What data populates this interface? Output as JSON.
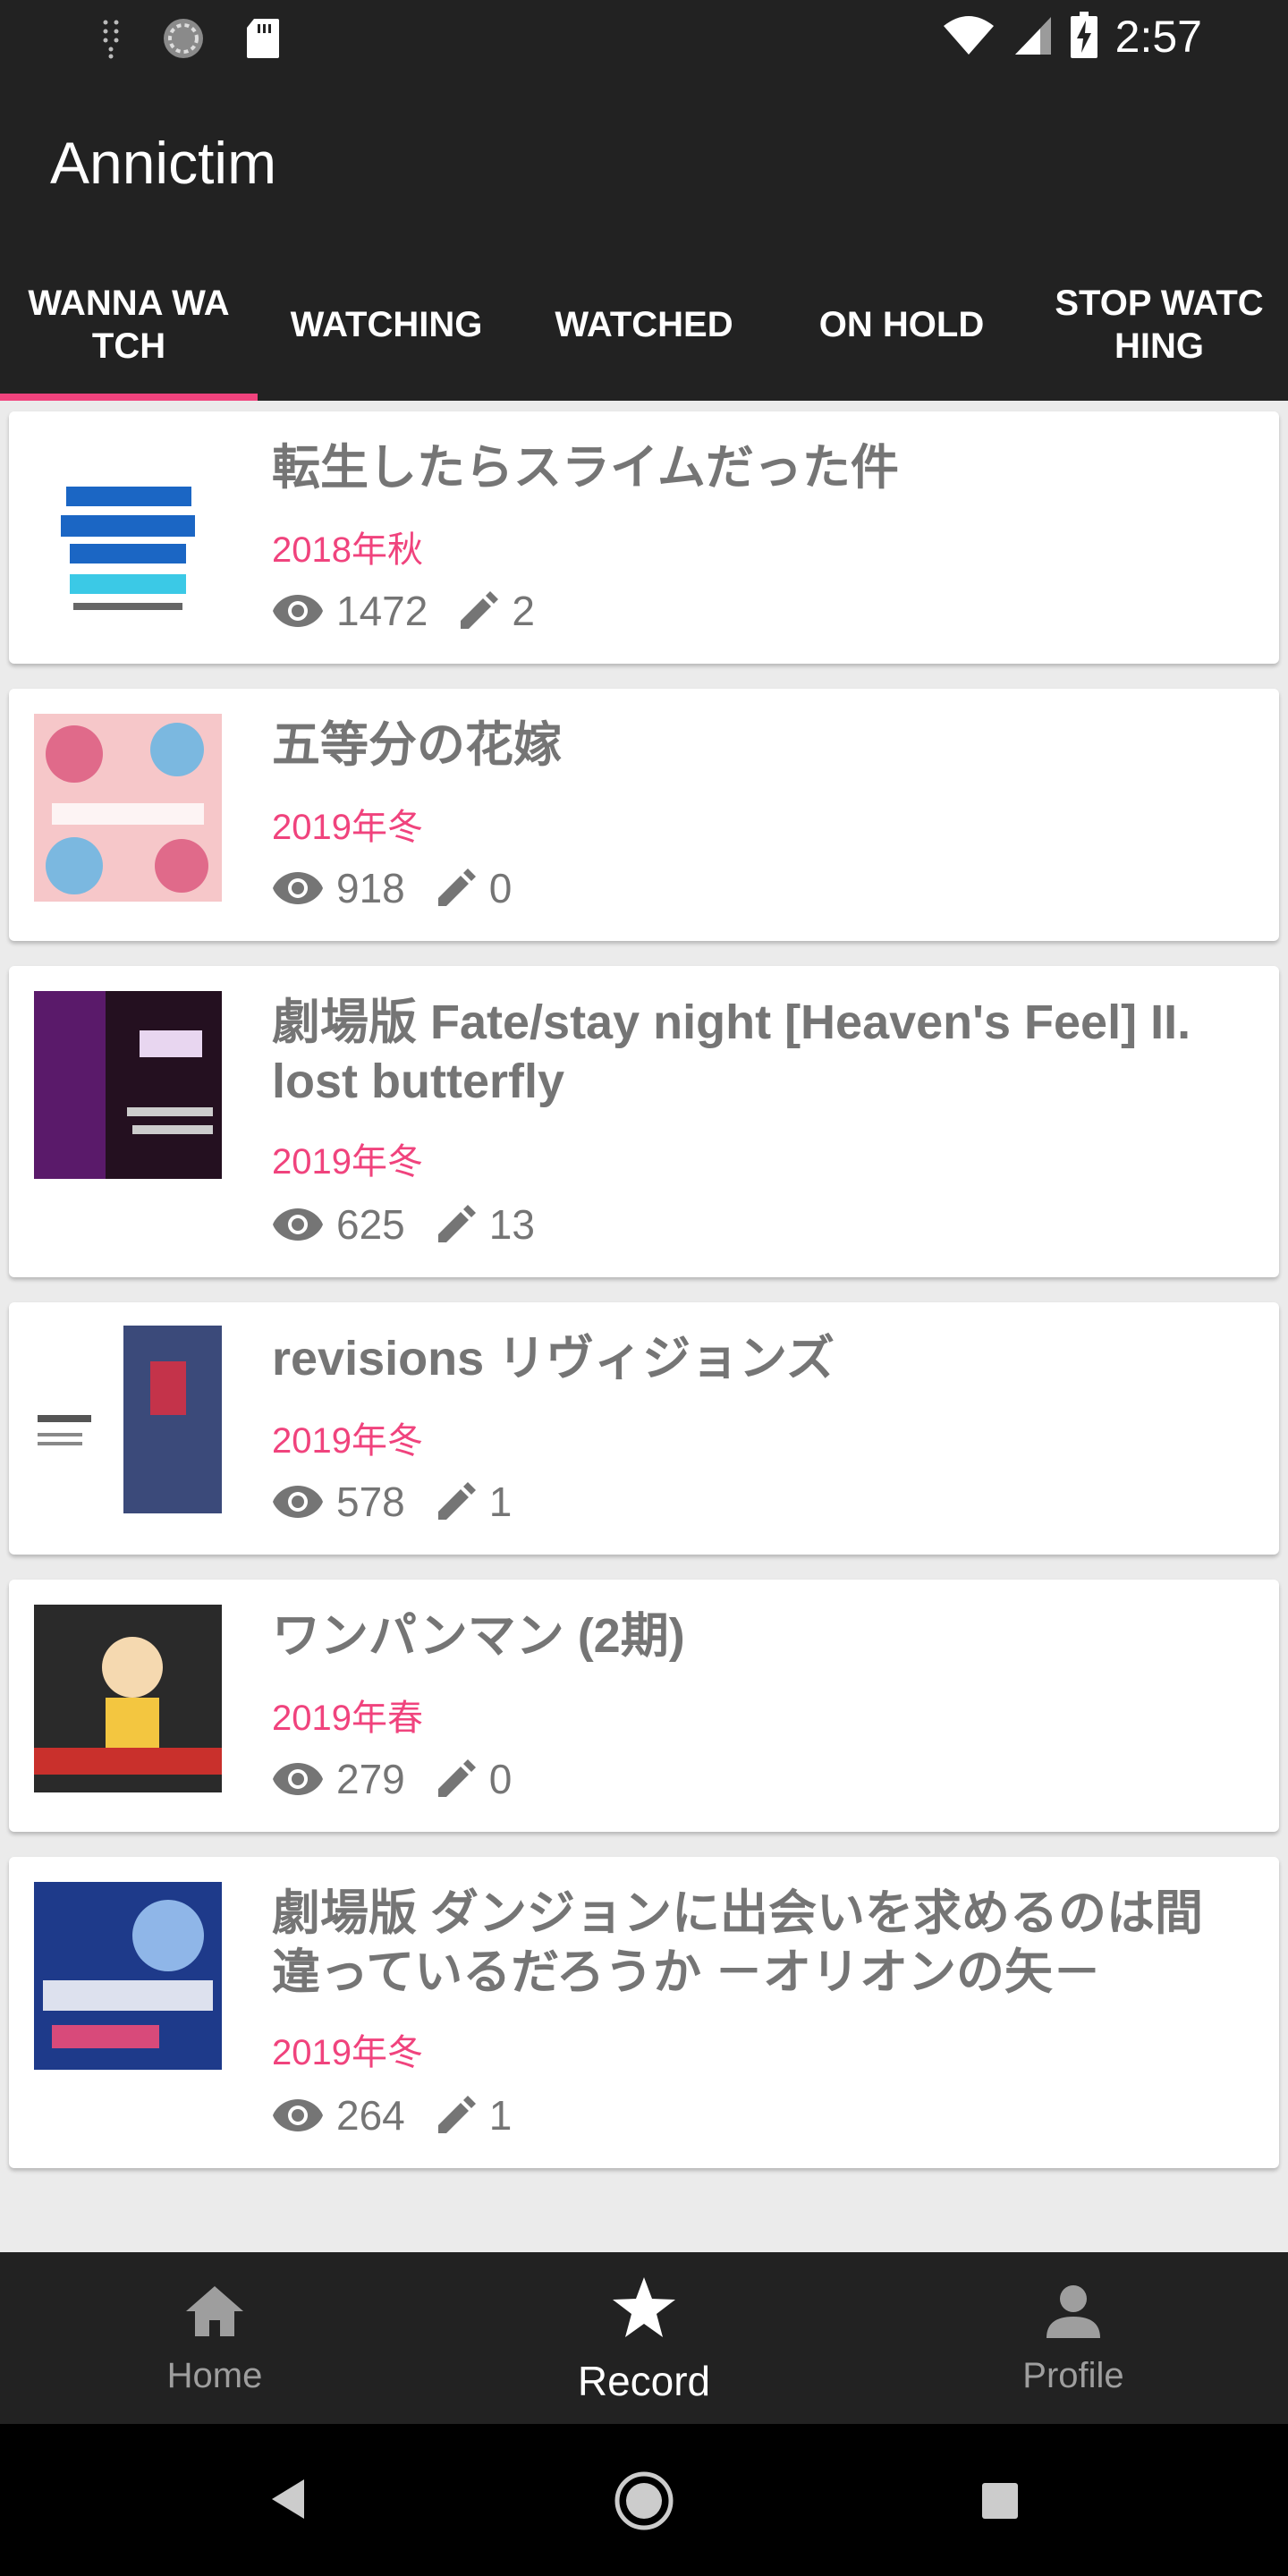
{
  "status_bar": {
    "time": "2:57",
    "icons": [
      "signal-dots-icon",
      "sync-icon",
      "sd-card-icon",
      "wifi-icon",
      "cell-signal-icon",
      "battery-charging-icon"
    ]
  },
  "app": {
    "title": "Annictim"
  },
  "tabs": [
    {
      "label": "WANNA WATCH",
      "active": true
    },
    {
      "label": "WATCHING",
      "active": false
    },
    {
      "label": "WATCHED",
      "active": false
    },
    {
      "label": "ON HOLD",
      "active": false
    },
    {
      "label": "STOP WATCHING",
      "active": false
    }
  ],
  "works": [
    {
      "title": "転生したらスライムだった件",
      "season": "2018年秋",
      "watchers": "1472",
      "records": "2",
      "thumb_colors": [
        "#ffffff",
        "#1b66c4",
        "#3bc9e6"
      ]
    },
    {
      "title": "五等分の花嫁",
      "season": "2019年冬",
      "watchers": "918",
      "records": "0",
      "thumb_colors": [
        "#f6c7c9",
        "#e06a8a",
        "#7bb8e0"
      ]
    },
    {
      "title": "劇場版 Fate/stay night [Heaven's Feel] II. lost butterfly",
      "season": "2019年冬",
      "watchers": "625",
      "records": "13",
      "thumb_colors": [
        "#5a1a6a",
        "#241020",
        "#e8d6f0"
      ]
    },
    {
      "title": "revisions リヴィジョンズ",
      "season": "2019年冬",
      "watchers": "578",
      "records": "1",
      "thumb_colors": [
        "#ffffff",
        "#3b4a7a",
        "#c4334a"
      ]
    },
    {
      "title": "ワンパンマン (2期)",
      "season": "2019年春",
      "watchers": "279",
      "records": "0",
      "thumb_colors": [
        "#2a2a2a",
        "#f3c640",
        "#c9302c"
      ]
    },
    {
      "title": "劇場版 ダンジョンに出会いを求めるのは間違っているだろうか －オリオンの矢－",
      "season": "2019年冬",
      "watchers": "264",
      "records": "1",
      "thumb_colors": [
        "#1e3a8a",
        "#8fb6e8",
        "#d84a7a"
      ]
    }
  ],
  "bottom_nav": [
    {
      "label": "Home",
      "icon": "home-icon",
      "active": false
    },
    {
      "label": "Record",
      "icon": "star-icon",
      "active": true
    },
    {
      "label": "Profile",
      "icon": "person-icon",
      "active": false
    }
  ],
  "system_nav": [
    "back-icon",
    "home-circle-icon",
    "recents-icon"
  ],
  "colors": {
    "accent": "#f0437d",
    "bar": "#222222",
    "text_secondary": "#757575"
  }
}
